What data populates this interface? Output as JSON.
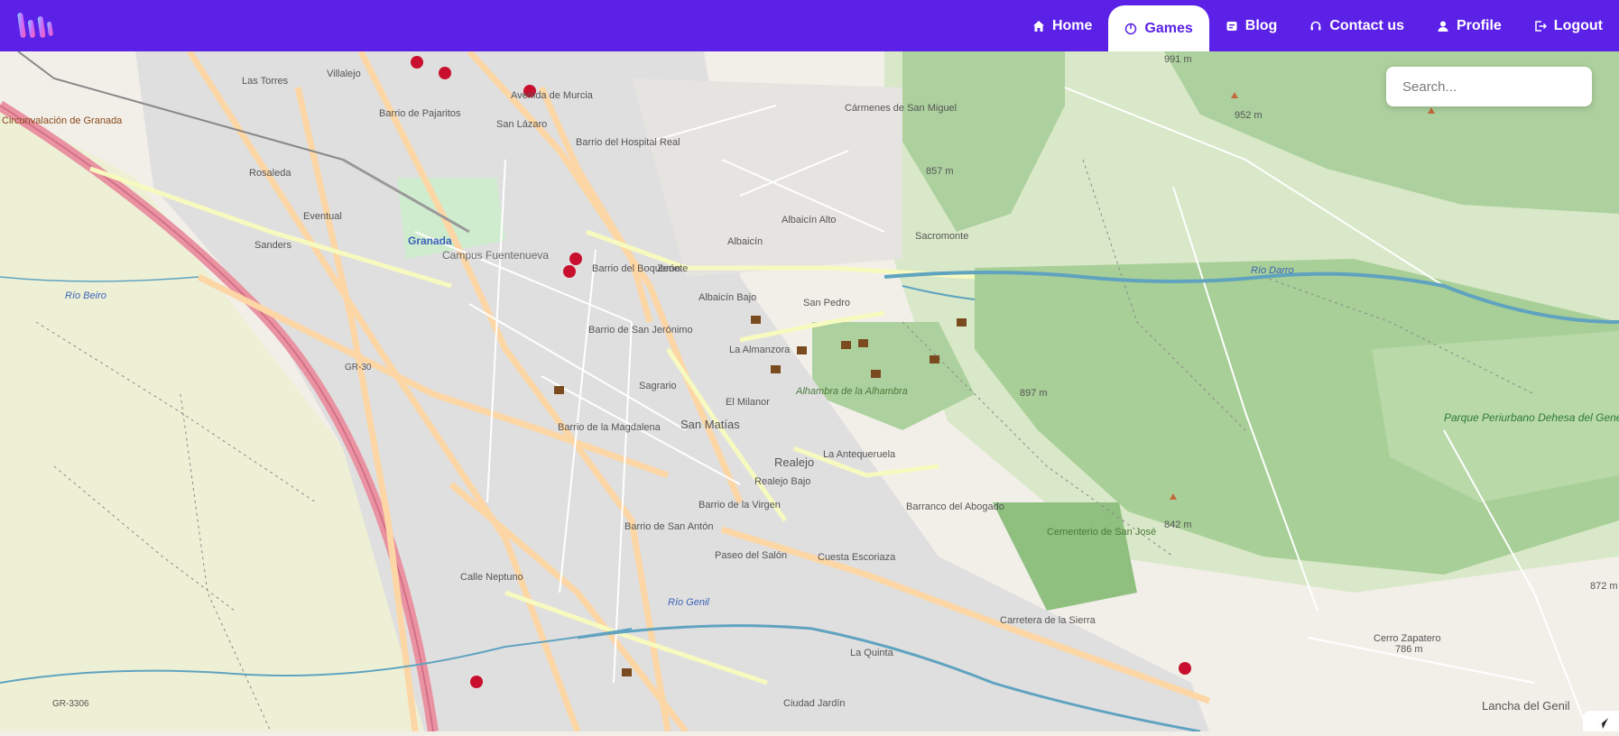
{
  "nav": {
    "items": [
      {
        "label": "Home",
        "icon": "home-icon"
      },
      {
        "label": "Games",
        "icon": "games-icon"
      },
      {
        "label": "Blog",
        "icon": "blog-icon"
      },
      {
        "label": "Contact us",
        "icon": "headset-icon"
      },
      {
        "label": "Profile",
        "icon": "user-icon"
      },
      {
        "label": "Logout",
        "icon": "logout-icon"
      }
    ],
    "active": "Games",
    "brand_color": "#5b21e6"
  },
  "search": {
    "placeholder": "Search..."
  },
  "map": {
    "labels": {
      "granada": "Granada",
      "albaicin": "Albaicín",
      "albaicin_alto": "Albaicín Alto",
      "albaicin_bajo": "Albaicín Bajo",
      "sacromonte": "Sacromonte",
      "san_pedro": "San Pedro",
      "la_almanzora": "La Almanzora",
      "el_milanor": "El Milanor",
      "alhambra": "Alhambra de la Alhambra",
      "la_antequeruela": "La Antequeruela",
      "realejo": "Realejo",
      "realejo_bajo": "Realejo Bajo",
      "barranco": "Barranco del Abogado",
      "barrio_virgen": "Barrio de la Virgen",
      "barrio_san_anton": "Barrio de San Antón",
      "barrio_magdalena": "Barrio de la Magdalena",
      "barrio_san_jeronimo": "Barrio de San Jerónimo",
      "barrio_boqueron": "Barrio del Boquerón",
      "barrio_hospital": "Barrio del Hospital Real",
      "san_lazaro": "San Lázaro",
      "zenete": "Zenete",
      "sagrario": "Sagrario",
      "san_matias": "San Matías",
      "villalejo": "Villalejo",
      "las_torres": "Las Torres",
      "rosaleda": "Rosaleda",
      "sanders": "Sanders",
      "eventual": "Eventual",
      "barrio_pajaritos": "Barrio de Pajaritos",
      "campus": "Campus Fuentenueva",
      "rio_beiro": "Río Beiro",
      "rio_genil": "Río Genil",
      "rio_darro": "Río Darro",
      "carmenes": "Cármenes de San Miguel",
      "parque": "Parque Periurbano Dehesa del Generalife",
      "cementerio": "Cementerio de San José",
      "la_quinta": "La Quinta",
      "ciudad_jardin": "Ciudad Jardín",
      "lancha": "Lancha del Genil",
      "cerro_zapatero": "Cerro Zapatero",
      "cerro_zapatero_alt": "786 m",
      "carretera_sierra": "Carretera de la Sierra",
      "paseo_salon": "Paseo del Salón",
      "cuesta_escoriaza": "Cuesta Escoriaza",
      "circunvalacion": "Circunvalación de Granada",
      "avenida_murcia": "Avenida de Murcia",
      "calle_neptuno": "Calle Neptuno",
      "gr30": "GR-30",
      "gr3306": "GR-3306",
      "elev_991": "991 m",
      "elev_952": "952 m",
      "elev_857": "857 m",
      "elev_897": "897 m",
      "elev_842": "842 m",
      "elev_872": "872 m"
    },
    "colors": {
      "land": "#f2efe9",
      "forest": "#add19e",
      "farmland": "#eef0d5",
      "urban": "#e0dfdf",
      "motorway": "#e892a2",
      "primary": "#fcd6a4",
      "secondary": "#f7fabf",
      "water": "#aad3df",
      "river": "#5fa3c0"
    }
  }
}
